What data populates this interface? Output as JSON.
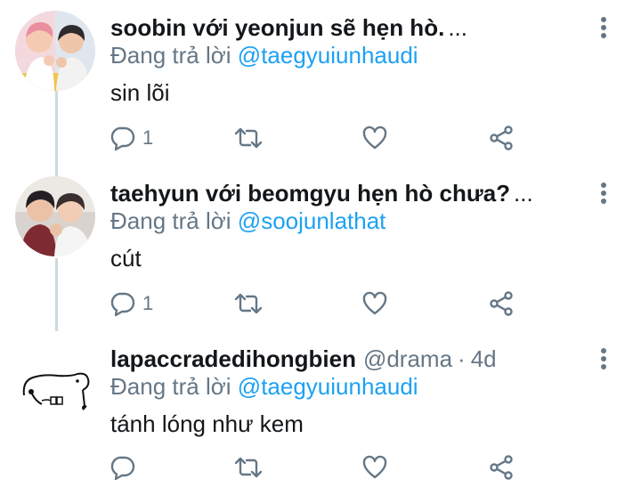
{
  "tweets": [
    {
      "name": "soobin với yeonjun sẽ hẹn hò.",
      "truncated": "...",
      "reply_label": "Đang trả lời",
      "reply_to": "@taegyuiunhaudi",
      "text": "sin lõi",
      "reply_count": "1",
      "avatar_icon": "photo-avatar-icon"
    },
    {
      "name": "taehyun với beomgyu hẹn hò chưa?",
      "truncated": "...",
      "reply_label": "Đang trả lời",
      "reply_to": "@soojunlathat",
      "text": "cút",
      "reply_count": "1",
      "avatar_icon": "photo-avatar-icon"
    },
    {
      "name": "lapaccradedihongbien",
      "handle": "@drama",
      "separator": "·",
      "time": "4d",
      "reply_label": "Đang trả lời",
      "reply_to": "@taegyuiunhaudi",
      "text": "tánh lóng như kem",
      "avatar_icon": "doodle-avatar-icon"
    }
  ],
  "colors": {
    "accent": "#1da1f2",
    "muted": "#657786",
    "text": "#14171a",
    "thread_line": "#cfd9de"
  },
  "icons": [
    "more-vertical-icon",
    "reply-icon",
    "retweet-icon",
    "like-icon",
    "share-icon"
  ]
}
